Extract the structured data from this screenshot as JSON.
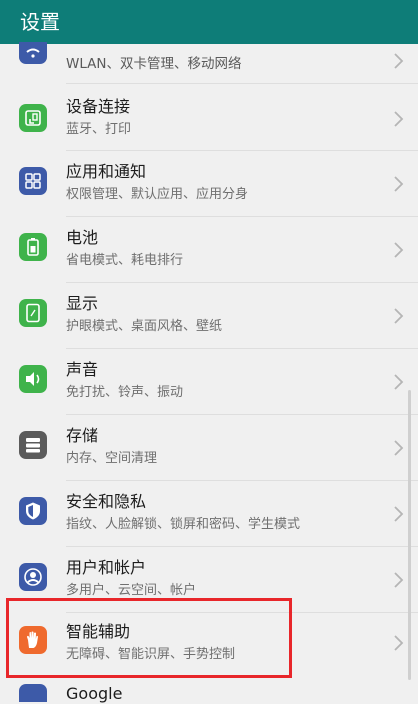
{
  "header": {
    "title": "设置"
  },
  "items": [
    {
      "title": "",
      "subtitle": "WLAN、双卡管理、移动网络",
      "icon": "wifi-icon",
      "color": "#3d5aa8"
    },
    {
      "title": "设备连接",
      "subtitle": "蓝牙、打印",
      "icon": "device-connect-icon",
      "color": "#3fb34b"
    },
    {
      "title": "应用和通知",
      "subtitle": "权限管理、默认应用、应用分身",
      "icon": "apps-grid-icon",
      "color": "#3d5aa8"
    },
    {
      "title": "电池",
      "subtitle": "省电模式、耗电排行",
      "icon": "battery-icon",
      "color": "#3fb34b"
    },
    {
      "title": "显示",
      "subtitle": "护眼模式、桌面风格、壁纸",
      "icon": "display-icon",
      "color": "#3fb34b"
    },
    {
      "title": "声音",
      "subtitle": "免打扰、铃声、振动",
      "icon": "speaker-icon",
      "color": "#3fb34b"
    },
    {
      "title": "存储",
      "subtitle": "内存、空间清理",
      "icon": "storage-icon",
      "color": "#5b5b5b"
    },
    {
      "title": "安全和隐私",
      "subtitle": "指纹、人脸解锁、锁屏和密码、学生模式",
      "icon": "shield-icon",
      "color": "#3d5aa8"
    },
    {
      "title": "用户和帐户",
      "subtitle": "多用户、云空间、帐户",
      "icon": "user-icon",
      "color": "#3d5aa8"
    },
    {
      "title": "智能辅助",
      "subtitle": "无障碍、智能识屏、手势控制",
      "icon": "hand-icon",
      "color": "#ef6a2e"
    }
  ],
  "next_item": {
    "title": "Google",
    "icon": "google-icon",
    "color": "#3d5aa8"
  }
}
